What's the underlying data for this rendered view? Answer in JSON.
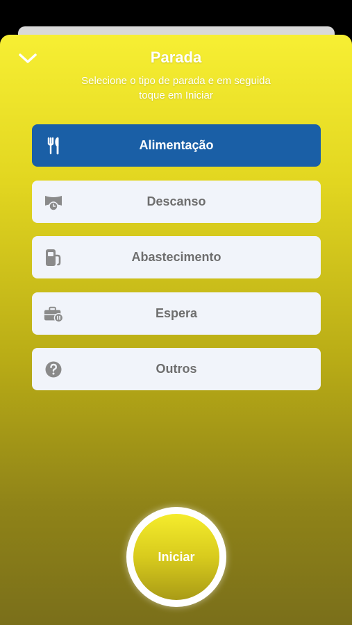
{
  "header": {
    "title": "Parada",
    "subtitle": "Selecione o tipo de parada e em seguida toque em Iniciar"
  },
  "options": [
    {
      "label": "Alimentação",
      "icon": "fork-knife-icon",
      "selected": true
    },
    {
      "label": "Descanso",
      "icon": "rest-clock-icon",
      "selected": false
    },
    {
      "label": "Abastecimento",
      "icon": "fuel-pump-icon",
      "selected": false
    },
    {
      "label": "Espera",
      "icon": "briefcase-pause-icon",
      "selected": false
    },
    {
      "label": "Outros",
      "icon": "question-circle-icon",
      "selected": false
    }
  ],
  "start_button": {
    "label": "Iniciar"
  },
  "colors": {
    "selected_option": "#1a5fa6",
    "option_bg": "#f1f4fa",
    "option_text": "#6e6e6e",
    "icon_gray": "#8a8a8a"
  }
}
